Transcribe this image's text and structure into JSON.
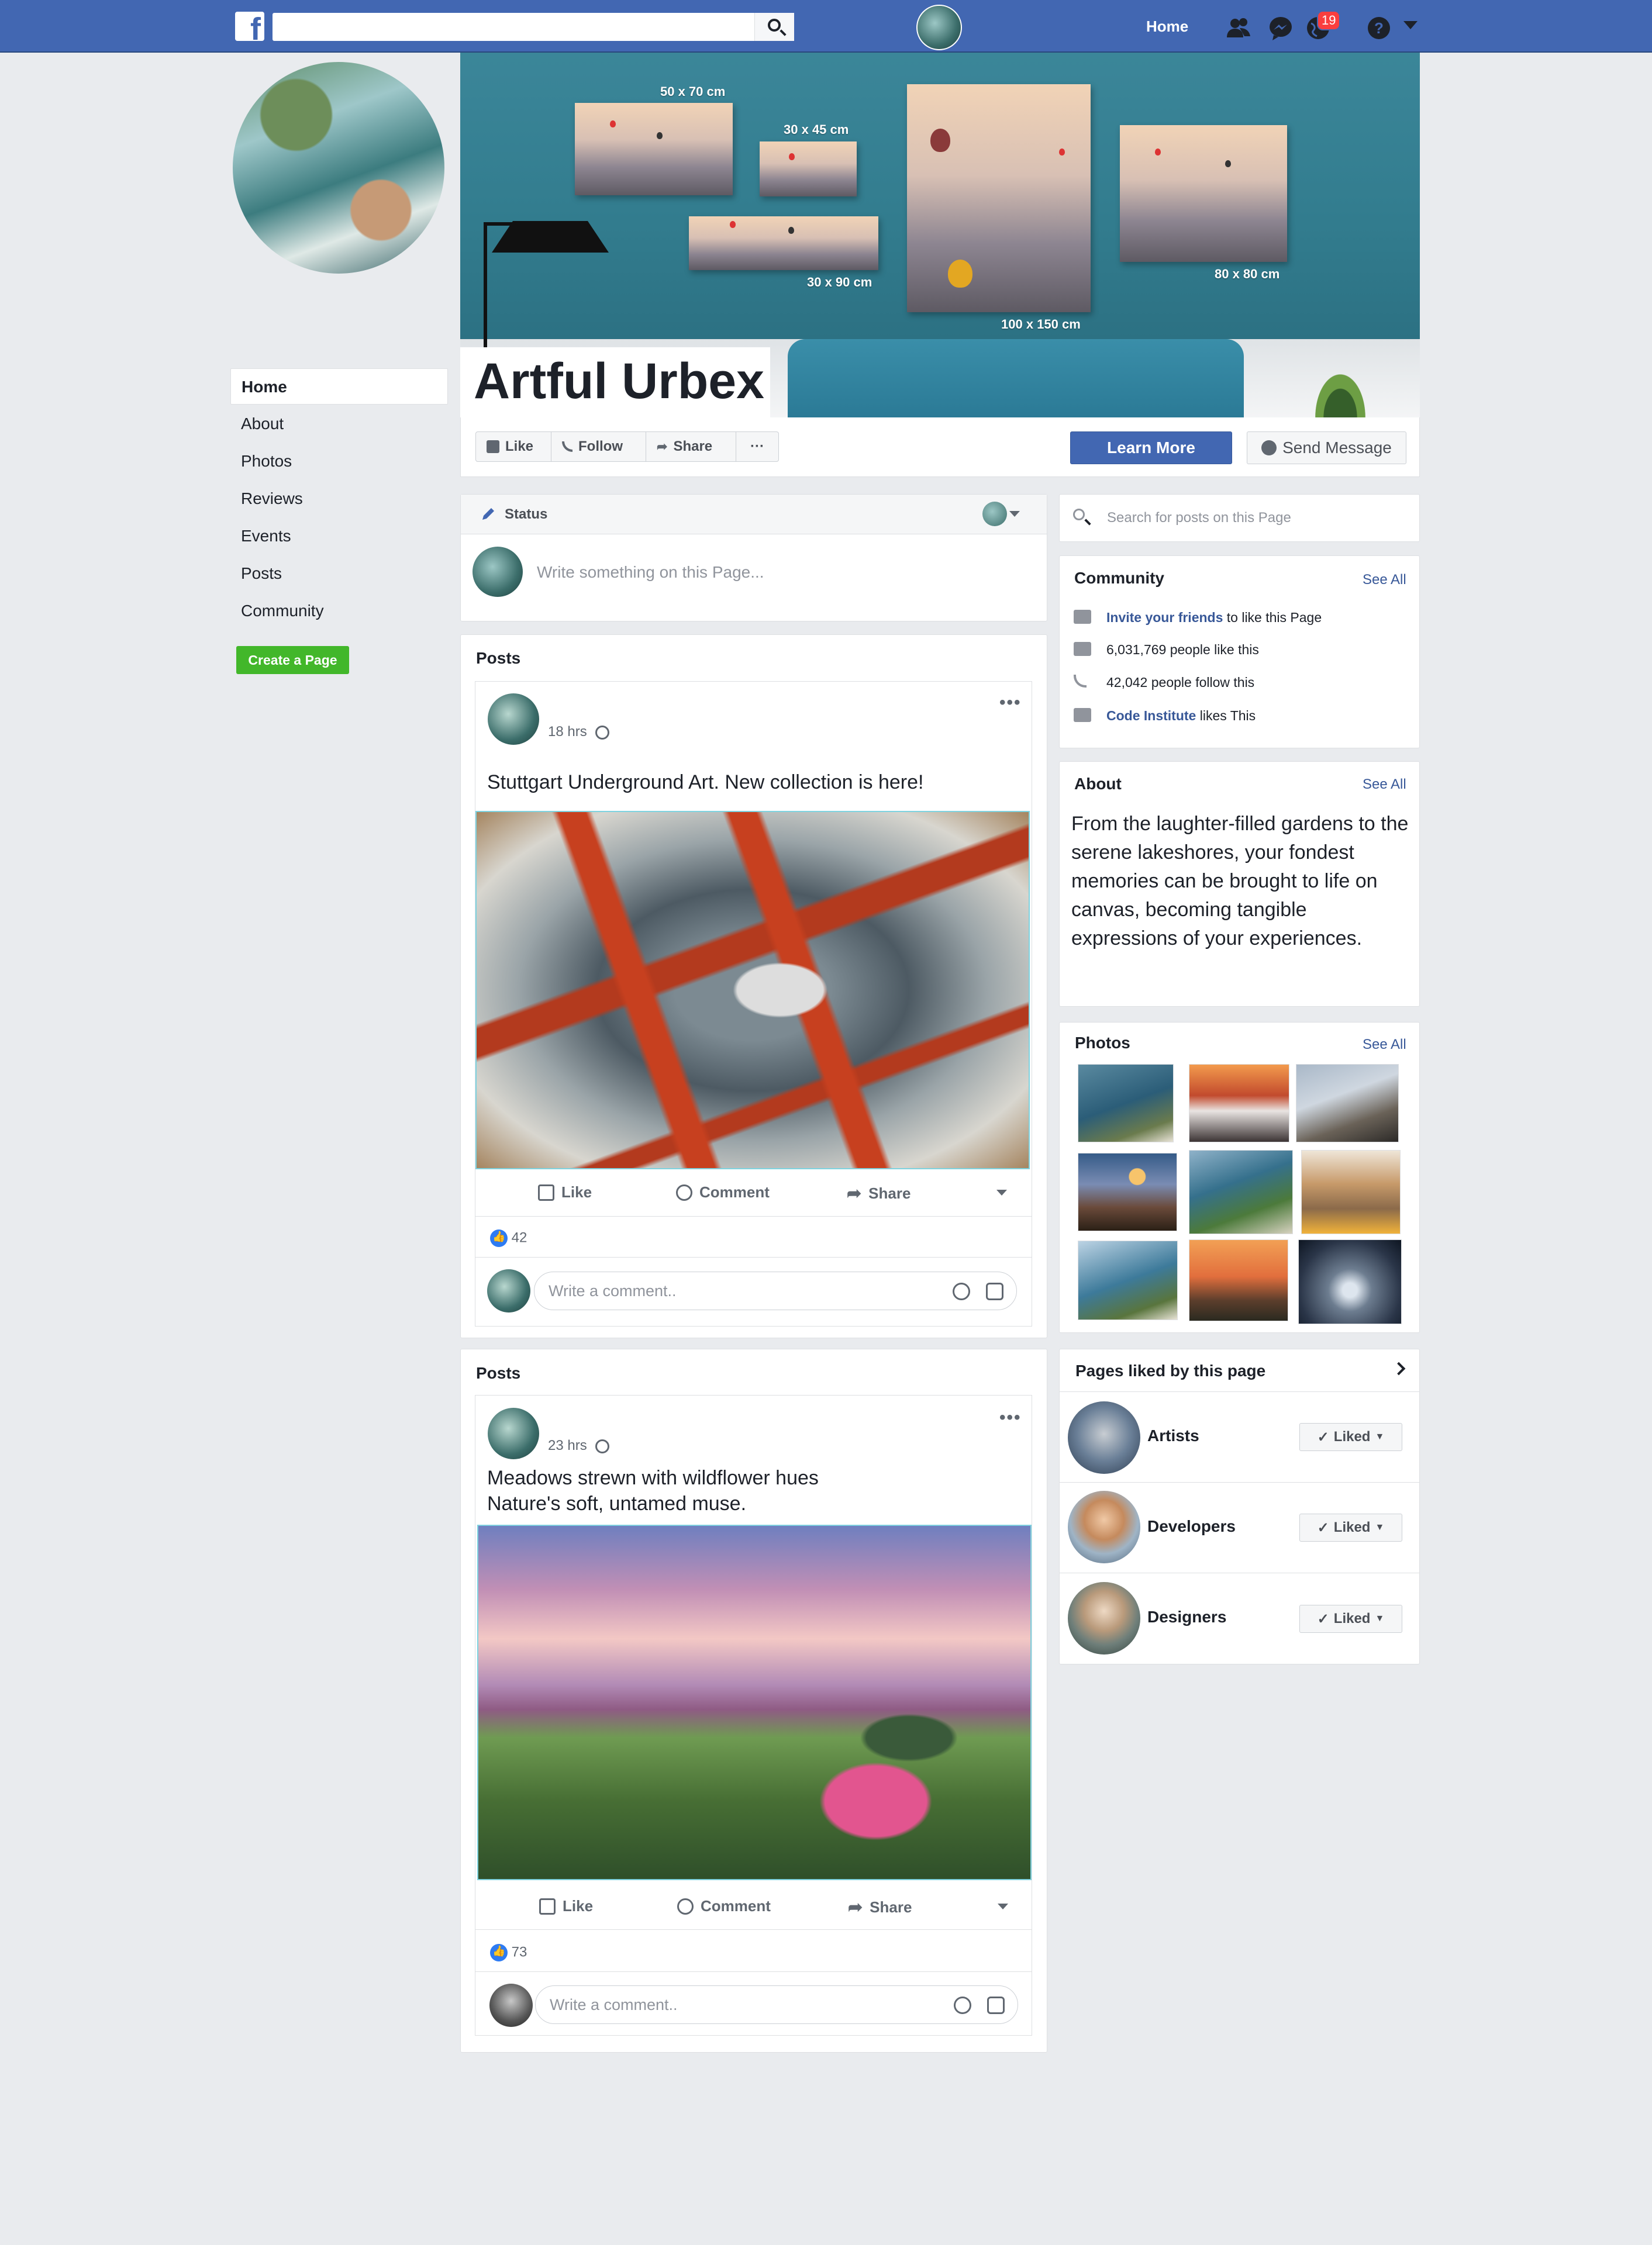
{
  "topbar": {
    "logo": "f",
    "home_label": "Home",
    "notification_count": "19"
  },
  "cover": {
    "frames": [
      "50 x 70 cm",
      "30 x 45 cm",
      "30 x 90 cm",
      "100 x 150 cm",
      "80 x 80 cm"
    ]
  },
  "page": {
    "name": "Artful Urbex"
  },
  "actions": {
    "like": "Like",
    "follow": "Follow",
    "share": "Share",
    "more": "···",
    "learn_more": "Learn More",
    "send_message": "Send Message"
  },
  "left_nav": {
    "items": [
      "Home",
      "About",
      "Photos",
      "Reviews",
      "Events",
      "Posts",
      "Community"
    ],
    "create_page": "Create a Page"
  },
  "status": {
    "tab_label": "Status",
    "placeholder": "Write something on this Page..."
  },
  "posts": [
    {
      "section_title": "Posts",
      "time": "18 hrs",
      "text_lines": [
        "Stuttgart Underground Art. New collection is here!"
      ],
      "actions": [
        "Like",
        "Comment",
        "Share"
      ],
      "like_count": "42",
      "comment_placeholder": "Write a comment.."
    },
    {
      "section_title": "Posts",
      "time": "23 hrs",
      "text_lines": [
        "Meadows strewn with wildflower hues",
        "Nature's soft, untamed muse."
      ],
      "actions": [
        "Like",
        "Comment",
        "Share"
      ],
      "like_count": "73",
      "comment_placeholder": "Write a comment.."
    }
  ],
  "sidebar": {
    "search_placeholder": "Search for posts on this Page",
    "community": {
      "title": "Community",
      "see_all": "See All",
      "invite_link": "Invite your friends",
      "invite_rest": "to like this Page",
      "likes": "6,031,769 people like this",
      "follows": "42,042 people follow this",
      "friend_link": "Code Institute",
      "friend_rest": "likes This"
    },
    "about": {
      "title": "About",
      "see_all": "See All",
      "text": "From the laughter-filled gardens to the serene lakeshores, your fondest memories can be brought to life on canvas, becoming tangible expressions of your experiences."
    },
    "photos": {
      "title": "Photos",
      "see_all": "See All"
    },
    "pages_liked": {
      "title": "Pages liked by this page",
      "items": [
        {
          "name": "Artists",
          "button": "Liked"
        },
        {
          "name": "Developers",
          "button": "Liked"
        },
        {
          "name": "Designers",
          "button": "Liked"
        }
      ]
    }
  },
  "colors": {
    "brand": "#4267b2",
    "link": "#385898",
    "create_page": "#42b72a",
    "badge": "#fa3e3e"
  }
}
